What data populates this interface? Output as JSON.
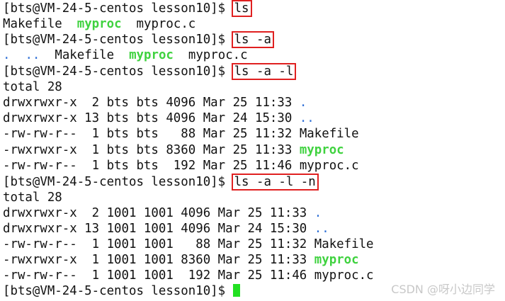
{
  "prompt": "[bts@VM-24-5-centos lesson10]$ ",
  "top_line": "                                     ",
  "cmd1": "ls",
  "out1": {
    "makefile": "Makefile",
    "myproc": "myproc",
    "myproc_c": "myproc.c"
  },
  "cmd2": "ls -a",
  "out2": {
    "dot": ".",
    "dotdot": "..",
    "makefile": "Makefile",
    "myproc": "myproc",
    "myproc_c": "myproc.c"
  },
  "cmd3": "ls -a -l",
  "long_listing": {
    "total": "total 28",
    "rows": [
      {
        "prefix": "drwxrwxr-x  2 bts bts 4096 Mar 25 11:33 ",
        "name": "."
      },
      {
        "prefix": "drwxrwxr-x 13 bts bts 4096 Mar 24 15:30 ",
        "name": ".."
      },
      {
        "prefix": "-rw-rw-r--  1 bts bts   88 Mar 25 11:32 ",
        "name": "Makefile"
      },
      {
        "prefix": "-rwxrwxr-x  1 bts bts 8360 Mar 25 11:33 ",
        "name": "myproc"
      },
      {
        "prefix": "-rw-rw-r--  1 bts bts  192 Mar 25 11:46 ",
        "name": "myproc.c"
      }
    ]
  },
  "cmd4": "ls -a -l -n",
  "numeric_listing": {
    "total": "total 28",
    "rows": [
      {
        "prefix": "drwxrwxr-x  2 1001 1001 4096 Mar 25 11:33 ",
        "name": "."
      },
      {
        "prefix": "drwxrwxr-x 13 1001 1001 4096 Mar 24 15:30 ",
        "name": ".."
      },
      {
        "prefix": "-rw-rw-r--  1 1001 1001   88 Mar 25 11:32 ",
        "name": "Makefile"
      },
      {
        "prefix": "-rwxrwxr-x  1 1001 1001 8360 Mar 25 11:33 ",
        "name": "myproc"
      },
      {
        "prefix": "-rw-rw-r--  1 1001 1001  192 Mar 25 11:46 ",
        "name": "myproc.c"
      }
    ]
  },
  "watermark": "CSDN @呀小边同学",
  "colors": {
    "directory": "#2f6fd6",
    "executable": "#3fd23f",
    "highlight_box": "#e02020",
    "cursor": "#22e022"
  }
}
